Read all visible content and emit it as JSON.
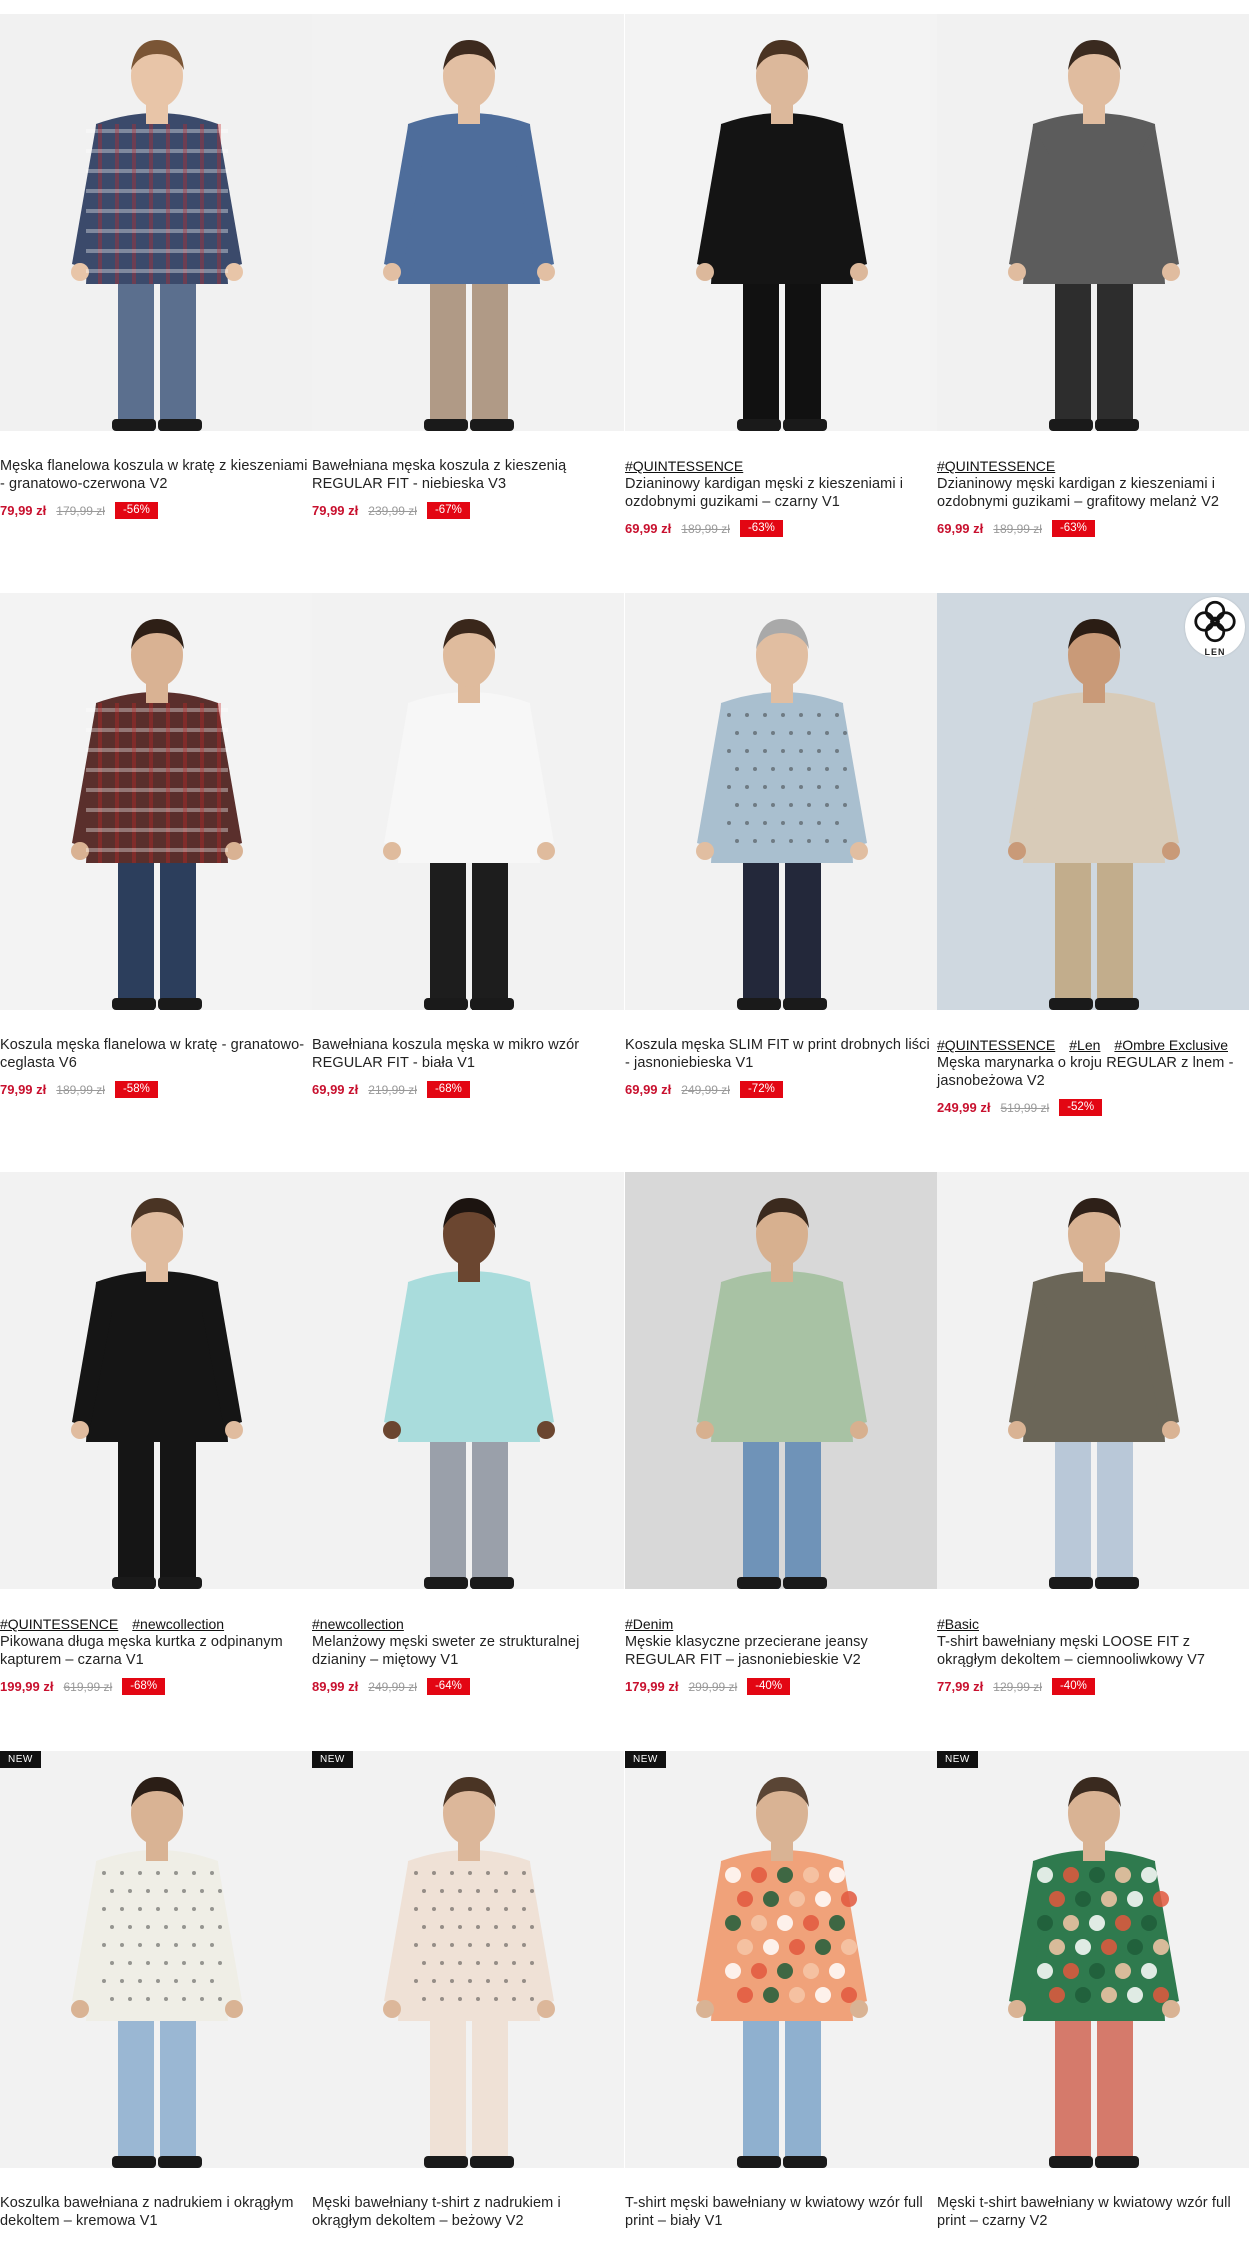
{
  "products": [
    {
      "tags": [],
      "title": "Męska flanelowa koszula w kratę z kieszeniami - granatowo-czerwona V2",
      "price": "79,99 zł",
      "old_price": "179,99 zł",
      "discount": "-56%",
      "badge": "",
      "len": false,
      "photo": {
        "bg": "#f1f1f1",
        "top": "#3b4a6b",
        "bottom": "#5b6f8e",
        "skin": "#e8c5a8",
        "hair": "#7a5535",
        "pattern": "plaid"
      }
    },
    {
      "tags": [],
      "title": "Bawełniana męska koszula z kieszenią REGULAR FIT - niebieska V3",
      "price": "79,99 zł",
      "old_price": "239,99 zł",
      "discount": "-67%",
      "badge": "",
      "len": false,
      "photo": {
        "bg": "#f2f2f2",
        "top": "#4e6d9b",
        "bottom": "#b09a86",
        "skin": "#e2bfa3",
        "hair": "#3d2a1e",
        "pattern": "plain"
      }
    },
    {
      "tags": [
        "#QUINTESSENCE"
      ],
      "title": "Dzianinowy kardigan męski z kieszeniami i ozdobnymi guzikami – czarny V1",
      "price": "69,99 zł",
      "old_price": "189,99 zł",
      "discount": "-63%",
      "badge": "",
      "len": false,
      "photo": {
        "bg": "#f3f3f3",
        "top": "#141414",
        "bottom": "#111111",
        "skin": "#dcb89b",
        "hair": "#4a3322",
        "pattern": "plain"
      }
    },
    {
      "tags": [
        "#QUINTESSENCE"
      ],
      "title": "Dzianinowy męski kardigan z kieszeniami i ozdobnymi guzikami – grafitowy melanż V2",
      "price": "69,99 zł",
      "old_price": "189,99 zł",
      "discount": "-63%",
      "badge": "",
      "len": false,
      "photo": {
        "bg": "#f1f1f1",
        "top": "#5c5c5c",
        "bottom": "#2d2d2d",
        "skin": "#e0bc9f",
        "hair": "#3a2a1f",
        "pattern": "plain"
      }
    },
    {
      "tags": [],
      "title": "Koszula męska flanelowa w kratę - granatowo-ceglasta V6",
      "price": "79,99 zł",
      "old_price": "189,99 zł",
      "discount": "-58%",
      "badge": "",
      "len": false,
      "photo": {
        "bg": "#f3f3f3",
        "top": "#5a2f2c",
        "bottom": "#2c3e5c",
        "skin": "#d9b293",
        "hair": "#2e1f16",
        "pattern": "plaid"
      }
    },
    {
      "tags": [],
      "title": "Bawełniana koszula męska w mikro wzór REGULAR FIT - biała V1",
      "price": "69,99 zł",
      "old_price": "219,99 zł",
      "discount": "-68%",
      "badge": "",
      "len": false,
      "photo": {
        "bg": "#f2f2f2",
        "top": "#f7f7f7",
        "bottom": "#1d1d1d",
        "skin": "#dfbb9d",
        "hair": "#3a271b",
        "pattern": "plain"
      }
    },
    {
      "tags": [],
      "title": "Koszula męska SLIM FIT w print drobnych liści - jasnoniebieska V1",
      "price": "69,99 zł",
      "old_price": "249,99 zł",
      "discount": "-72%",
      "badge": "",
      "len": false,
      "photo": {
        "bg": "#f2f2f2",
        "top": "#a9bfcf",
        "bottom": "#23283a",
        "skin": "#e1bea1",
        "hair": "#a9a9a9",
        "pattern": "dots"
      }
    },
    {
      "tags": [
        "#QUINTESSENCE",
        "#Len",
        "#Ombre Exclusive"
      ],
      "title": "Męska marynarka o kroju REGULAR z lnem - jasnobeżowa V2",
      "price": "249,99 zł",
      "old_price": "519,99 zł",
      "discount": "-52%",
      "badge": "",
      "len": true,
      "len_label": "LEN",
      "photo": {
        "bg": "#cfd8e0",
        "top": "#d8cbb8",
        "bottom": "#c2ad8c",
        "skin": "#c99a78",
        "hair": "#2b1d14",
        "pattern": "plain"
      }
    },
    {
      "tags": [
        "#QUINTESSENCE",
        "#newcollection"
      ],
      "title": "Pikowana długa męska kurtka z odpinanym kapturem – czarna V1",
      "price": "199,99 zł",
      "old_price": "619,99 zł",
      "discount": "-68%",
      "badge": "",
      "len": false,
      "photo": {
        "bg": "#f2f2f2",
        "top": "#151515",
        "bottom": "#151515",
        "skin": "#e0bc9f",
        "hair": "#4a3424",
        "pattern": "plain"
      }
    },
    {
      "tags": [
        "#newcollection"
      ],
      "title": "Melanżowy męski sweter ze strukturalnej dzianiny – miętowy V1",
      "price": "89,99 zł",
      "old_price": "249,99 zł",
      "discount": "-64%",
      "badge": "",
      "len": false,
      "photo": {
        "bg": "#f2f2f2",
        "top": "#a9dcdc",
        "bottom": "#9aa0aa",
        "skin": "#6b4630",
        "hair": "#1c1410",
        "pattern": "plain"
      }
    },
    {
      "tags": [
        "#Denim"
      ],
      "title": "Męskie klasyczne przecierane jeansy REGULAR FIT – jasnoniebieskie V2",
      "price": "179,99 zł",
      "old_price": "299,99 zł",
      "discount": "-40%",
      "badge": "",
      "len": false,
      "photo": {
        "bg": "#d8d8d8",
        "top": "#a8c2a4",
        "bottom": "#6f93b8",
        "skin": "#d7b08f",
        "hair": "#3b2a1e",
        "pattern": "plain"
      }
    },
    {
      "tags": [
        "#Basic"
      ],
      "title": "T-shirt bawełniany męski LOOSE FIT z okrągłym dekoltem – ciemnooliwkowy V7",
      "price": "77,99 zł",
      "old_price": "129,99 zł",
      "discount": "-40%",
      "badge": "",
      "len": false,
      "photo": {
        "bg": "#f2f2f2",
        "top": "#6b6658",
        "bottom": "#b9c8d8",
        "skin": "#d9b394",
        "hair": "#2e2018",
        "pattern": "plain"
      }
    },
    {
      "tags": [],
      "title": "Koszulka bawełniana z nadrukiem i okrągłym dekoltem – kremowa V1",
      "price": "",
      "old_price": "",
      "discount": "",
      "badge": "NEW",
      "len": false,
      "photo": {
        "bg": "#f2f2f2",
        "top": "#efeee6",
        "bottom": "#9ab7d3",
        "skin": "#d9b394",
        "hair": "#2b1e16",
        "pattern": "dots"
      }
    },
    {
      "tags": [],
      "title": "Męski bawełniany t-shirt z nadrukiem i okrągłym dekoltem – beżowy V2",
      "price": "",
      "old_price": "",
      "discount": "",
      "badge": "NEW",
      "len": false,
      "photo": {
        "bg": "#f2f2f2",
        "top": "#efe1d6",
        "bottom": "#efe1d6",
        "skin": "#dcb79a",
        "hair": "#4a3424",
        "pattern": "dots"
      }
    },
    {
      "tags": [],
      "title": "T-shirt męski bawełniany w kwiatowy wzór full print – biały V1",
      "price": "",
      "old_price": "",
      "discount": "",
      "badge": "NEW",
      "len": false,
      "photo": {
        "bg": "#f2f2f2",
        "top": "#f0a27a",
        "bottom": "#8fb0cf",
        "skin": "#d9b394",
        "hair": "#5a4535",
        "pattern": "floral"
      }
    },
    {
      "tags": [],
      "title": "Męski t-shirt bawełniany w kwiatowy wzór full print – czarny V2",
      "price": "",
      "old_price": "",
      "discount": "",
      "badge": "NEW",
      "len": false,
      "photo": {
        "bg": "#f2f2f2",
        "top": "#2f7a4e",
        "bottom": "#d57a6b",
        "skin": "#d9b394",
        "hair": "#3a2a1f",
        "pattern": "floral"
      }
    }
  ]
}
